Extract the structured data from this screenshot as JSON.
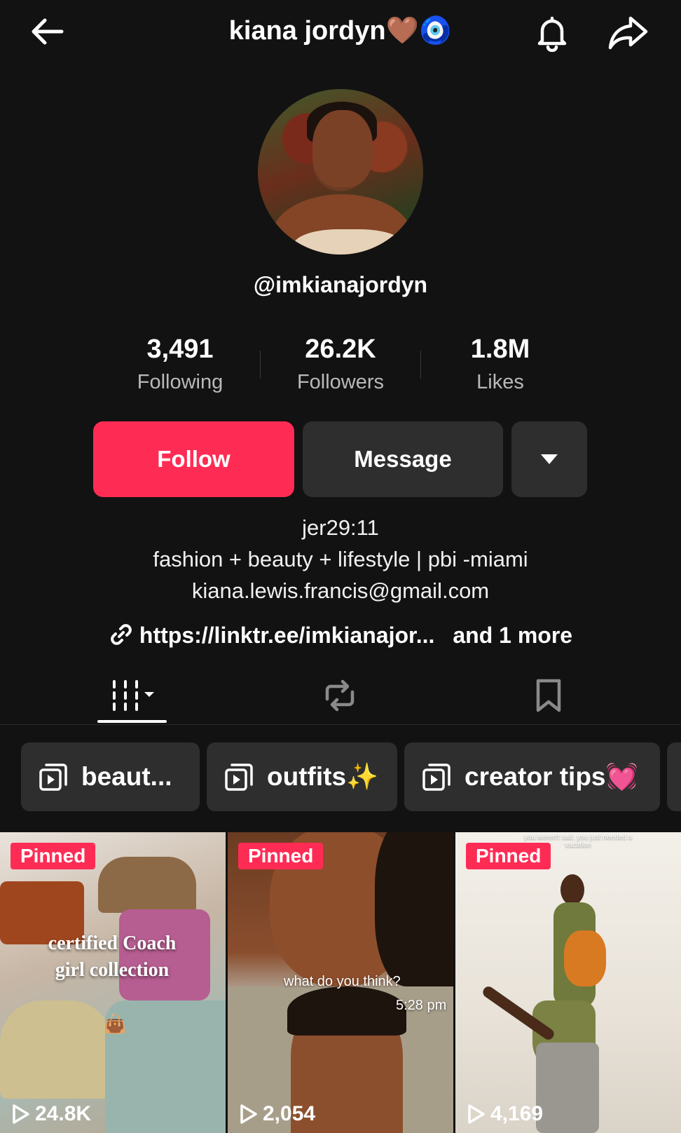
{
  "header": {
    "title": "kiana jordyn🤎🧿"
  },
  "profile": {
    "handle": "@imkianajordyn",
    "stats": [
      {
        "value": "3,491",
        "label": "Following"
      },
      {
        "value": "26.2K",
        "label": "Followers"
      },
      {
        "value": "1.8M",
        "label": "Likes"
      }
    ],
    "actions": {
      "follow_label": "Follow",
      "message_label": "Message"
    },
    "bio": {
      "line1": "jer29:11",
      "line2": "fashion + beauty + lifestyle | pbi -miami",
      "line3": "kiana.lewis.francis@gmail.com"
    },
    "link": {
      "url": "https://linktr.ee/imkianajor...",
      "more": "and 1 more"
    }
  },
  "playlists": [
    {
      "label": "beaut..."
    },
    {
      "label": "outfits✨"
    },
    {
      "label": "creator tips💓"
    }
  ],
  "videos": [
    {
      "badge": "Pinned",
      "views": "24.8K",
      "overlay": "certified Coach girl collection",
      "overlay_emoji": "👜"
    },
    {
      "badge": "Pinned",
      "views": "2,054",
      "caption": "what do you think?",
      "time": "5:28 pm"
    },
    {
      "badge": "Pinned",
      "views": "4,169",
      "caption": "you weren't sad, you just needed a vacation"
    }
  ],
  "colors": {
    "background": "#121212",
    "accent": "#fe2c55",
    "button_dark": "#2e2e2e",
    "muted_text": "#b9b9b9"
  },
  "icons": {
    "back": "back-arrow-icon",
    "bell": "bell-icon",
    "share": "share-arrow-icon",
    "dropdown": "caret-down-icon",
    "link": "link-icon",
    "videos_tab": "grid-icon",
    "reposts_tab": "repost-icon",
    "saved_tab": "bookmark-icon",
    "playlist": "playlist-icon",
    "play": "play-icon"
  }
}
